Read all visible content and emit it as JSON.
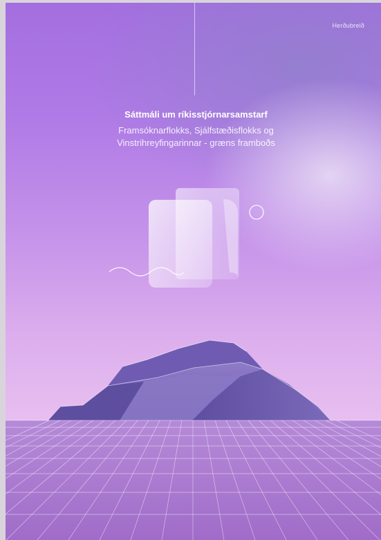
{
  "publisher": "Herðubreið",
  "title": "Sáttmáli um ríkisstjórnarsamstarf",
  "subtitle": {
    "line1": "Framsóknarflokks, Sjálfstæðisflokks og",
    "line2": "Vinstrihreyfingarinnar - græns framboðs"
  },
  "colors": {
    "bg_top": "#a46ee0",
    "bg_bottom": "#e4b8ec",
    "mountain_dark": "#5e4ea0",
    "grid_line": "#ffffff"
  },
  "icons": [
    "document-pages-icon",
    "circle-outline-icon",
    "wave-line-icon",
    "mountain-illustration",
    "grid-floor"
  ]
}
